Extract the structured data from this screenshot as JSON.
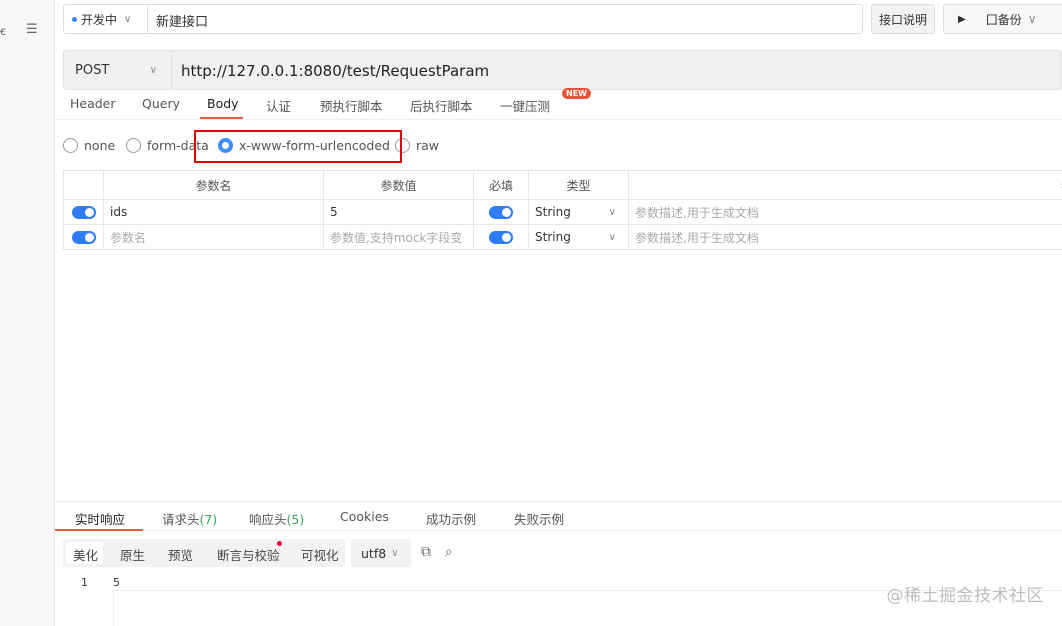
{
  "rail": {
    "icon1": "ꞓ",
    "icon2": "☰"
  },
  "header": {
    "env": "开发中",
    "api_name": "新建接口",
    "doc_label": "接口说明",
    "run_label": "▶",
    "backup_label": "囗备份"
  },
  "request": {
    "method": "POST",
    "url": "http://127.0.0.1:8080/test/RequestParam"
  },
  "tabs": [
    {
      "label": "Header"
    },
    {
      "label": "Query"
    },
    {
      "label": "Body"
    },
    {
      "label": "认证"
    },
    {
      "label": "预执行脚本"
    },
    {
      "label": "后执行脚本"
    },
    {
      "label": "一键压测"
    }
  ],
  "new_badge": "NEW",
  "body_modes": [
    {
      "label": "none"
    },
    {
      "label": "form-data"
    },
    {
      "label": "x-www-form-urlencoded"
    },
    {
      "label": "raw"
    }
  ],
  "params_table": {
    "headers": [
      "参数名",
      "参数值",
      "必填",
      "类型",
      "参"
    ],
    "rows": [
      {
        "name": "ids",
        "value": "5",
        "type": "String",
        "desc": "参数描述,用于生成文档"
      },
      {
        "name": "参数名",
        "value": "参数值,支持mock字段变",
        "type": "String",
        "desc": "参数描述,用于生成文档"
      }
    ]
  },
  "response_tabs": [
    {
      "label": "实时响应"
    },
    {
      "label": "请求头",
      "count": "(7)"
    },
    {
      "label": "响应头",
      "count": "(5)"
    },
    {
      "label": "Cookies"
    },
    {
      "label": "成功示例"
    },
    {
      "label": "失败示例"
    }
  ],
  "view_modes": [
    {
      "label": "美化"
    },
    {
      "label": "原生"
    },
    {
      "label": "预览"
    },
    {
      "label": "断言与校验"
    },
    {
      "label": "可视化"
    }
  ],
  "encoding": "utf8",
  "response_body": {
    "line_no": "1",
    "content": "5"
  },
  "watermark": "@稀土掘金技术社区",
  "colors": {
    "accent": "#e85d3f",
    "toggle": "#2f7cf6",
    "radio": "#3f8ef7",
    "highlight": "#e00000"
  }
}
